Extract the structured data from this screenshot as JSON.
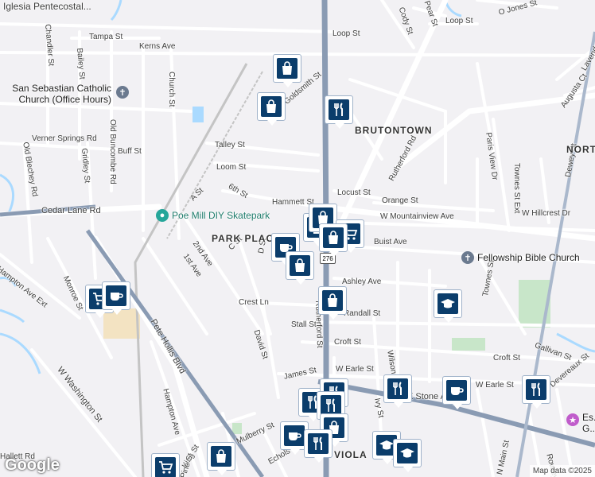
{
  "labels": {
    "streets": [
      "Iglesia Pentecostal...",
      "Tampa St",
      "Kerns Ave",
      "Chandler St",
      "Bailey St",
      "Loop St",
      "Church St",
      "Verner Springs Rd",
      "Buff St",
      "Gridley St",
      "Old Blechey Rd",
      "Old Buncombe Rd",
      "Talley St",
      "Loom St",
      "6th St",
      "A St",
      "Hammett St",
      "Locust St",
      "Orange St",
      "Rutherford Rd",
      "W Mountainview Ave",
      "Buist Ave",
      "W Hillcrest Dr",
      "Paris View Dr",
      "Townes St Ext",
      "N Main St",
      "Cedar Lane Rd",
      "2nd Ave",
      "C St",
      "1st Ave",
      "D St",
      "Ashley Ave",
      "Crest Ln",
      "Stall St",
      "Croft St",
      "David St",
      "James St",
      "W Earle St",
      "E Stone Ave",
      "Pete Hollis Blvd",
      "Monroe St",
      "W Washington St",
      "Hampton Ave",
      "Hampton Ave Ext",
      "King St",
      "Mulberry St",
      "Echols St",
      "Cody St",
      "Pear St",
      "O Jones St",
      "Goldsmith St",
      "Rutherford St",
      "Gallivan St",
      "Townes St",
      "Croft St",
      "W Earle St",
      "Ivy St",
      "Wilson St",
      "Randall St",
      "Lavender St",
      "Dewey St",
      "Hallett Rd",
      "Pine St",
      "Devereaux St",
      "Rowley St",
      "Augusta Ct"
    ],
    "areas": [
      "BRUTONTOWN",
      "PARK PLACE",
      "NORTH",
      "VIOLA"
    ],
    "pois": [
      "San Sebastian Catholic Church (Office Hours)",
      "Poe Mill DIY Skatepark",
      "Fellowship Bible Church",
      "Es... G..."
    ]
  },
  "route": "276",
  "markers": [
    "shopping-bag",
    "shopping-bag",
    "restaurant",
    "shopping-bag",
    "shopping-bag",
    "shopping-cart",
    "coffee",
    "shopping-bag",
    "shopping-bag",
    "shopping-cart",
    "coffee",
    "school",
    "restaurant",
    "coffee",
    "restaurant",
    "restaurant",
    "restaurant",
    "shopping-bag",
    "coffee",
    "restaurant",
    "school",
    "school",
    "shopping-cart",
    "shopping-bag"
  ],
  "footer": {
    "logo": "Google",
    "attribution": "Map data ©2025"
  },
  "colors": {
    "background": "#f2f1f4",
    "road": "#ffffff",
    "highway": "#8a9bb3",
    "water": "#aadaff",
    "park": "#c8e6c9",
    "marker": "#0b3d6b",
    "railway": "#bdbdbd"
  }
}
